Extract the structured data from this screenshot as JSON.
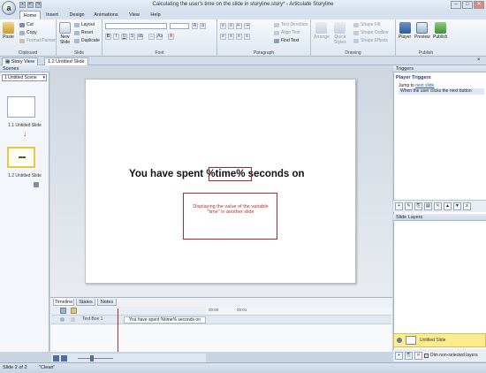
{
  "window": {
    "title": "Calculating the user's time on the slide in storyline.story* - Articulate Storyline",
    "app_letter": "a"
  },
  "tabs": [
    "Home",
    "Insert",
    "Design",
    "Animations",
    "View",
    "Help"
  ],
  "ribbon": {
    "clipboard": {
      "paste": "Paste",
      "cut": "Cut",
      "copy": "Copy",
      "format_painter": "Format Painter",
      "label": "Clipboard"
    },
    "slide": {
      "new_slide": "New\nSlide",
      "layout": "Layout",
      "reset": "Reset",
      "duplicate": "Duplicate",
      "label": "Slide"
    },
    "font": {
      "label": "Font"
    },
    "paragraph": {
      "text_direction": "Text Direction",
      "align_text": "Align Text",
      "find_text": "Find Text",
      "label": "Paragraph"
    },
    "drawing": {
      "arrange": "Arrange",
      "quick_styles": "Quick\nStyles",
      "shape_fill": "Shape Fill",
      "shape_outline": "Shape Outline",
      "shape_effects": "Shape Effects",
      "label": "Drawing"
    },
    "publish": {
      "player": "Player",
      "preview": "Preview",
      "publish": "Publish",
      "label": "Publish"
    }
  },
  "doc_tabs": [
    "Story View",
    "1.2 Untitled Slide"
  ],
  "scenes": {
    "header": "Scenes",
    "selected_scene": "1 Untitled Scene",
    "slides": [
      "1.1 Untitled Slide",
      "1.2 Untitled Slide"
    ]
  },
  "slide": {
    "text_before": "You have spent ",
    "variable": "%time%",
    "text_after": " seconds on",
    "caption": "Displaying the value of the variable \"time\" in another slide"
  },
  "timeline": {
    "tabs": [
      "Timeline",
      "States",
      "Notes"
    ],
    "row_label": "Text Box 1",
    "bar_text": "You have spent %time% seconds on",
    "ticks": [
      "00:00",
      "00:01"
    ]
  },
  "triggers": {
    "header": "Triggers",
    "section": "Player Triggers",
    "action_prefix": "Jump to ",
    "action_link": "next slide",
    "condition": "When the user clicks the next button"
  },
  "layers": {
    "header": "Slide Layers",
    "base_layer": "Untitled Slide",
    "dim_option": "Dim non-selected layers"
  },
  "status": {
    "slide_info": "Slide 2 of 2",
    "theme": "\"Clean\""
  }
}
